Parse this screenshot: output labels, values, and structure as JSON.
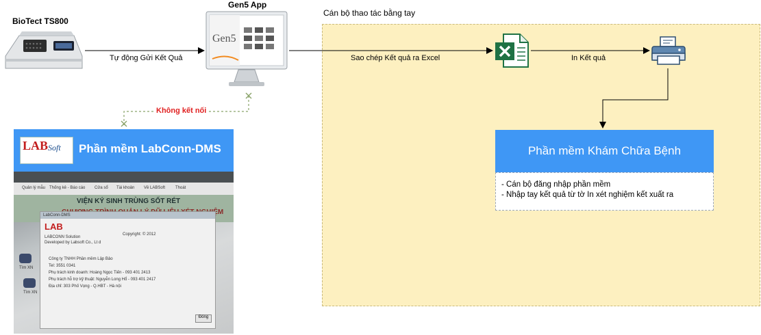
{
  "devices": {
    "biotek_label": "BioTect TS800",
    "gen5_label": "Gen5 App",
    "gen5_screen_text": "Gen5"
  },
  "edges": {
    "auto_send": "Tự động Gửi Kết Quả",
    "copy_excel": "Sao chép Kết quả ra Excel",
    "print_result": "In Kết quả",
    "no_connection": "Không kết nối"
  },
  "manual_area": {
    "title": "Cán bộ thao tác bằng tay",
    "fill_color": "#fdf0c0"
  },
  "exam_software": {
    "title": "Phần mềm Khám Chữa Bệnh",
    "lines": [
      "- Cán bộ đăng nhập phần mềm",
      "- Nhập tay kết quả từ tờ In xét nghiệm kết xuất ra"
    ],
    "header_color": "#3f97f5"
  },
  "labconn": {
    "title": "Phần mềm LabConn-DMS",
    "logo_text": "LAB",
    "logo_soft": "Soft",
    "photo": {
      "banner_line1": "VIỆN KÝ SINH TRÙNG SỐT RÉT",
      "banner_line2": "CHƯƠNG TRÌNH QUẢN LÝ DỮ LIỆU XÉT NGHIỆM",
      "menu_items": [
        "Quản lý mẫu",
        "Thống kê - Báo cáo",
        "Cửa sổ",
        "Tài khoản",
        "Về LABSoft",
        "Thoát"
      ],
      "dialog_title": "LabConn-DMS",
      "dialog_logo": "LAB",
      "dialog_lines": [
        "LABCONN Solution",
        "Developed by Labsoft Co., Lt d",
        "Copyright: © 2012",
        "Công ty TNHH Phần mềm Lập Bảo",
        "Tel: 3551 0341",
        "Phụ trách kinh doanh: Hoàng Ngọc Tiến - 093 401 2413",
        "Phụ trách hỗ trợ kỹ thuật: Nguyễn Long Hổ - 093 401 2417",
        "Địa chỉ: 303 Phố Vọng - Q.HBT - Hà nội"
      ],
      "desktop_icons": [
        "Tìm XN",
        "Tìm XN"
      ],
      "ok_button": "Đóng"
    }
  },
  "colors": {
    "accent_blue": "#3f97f5",
    "excel_green": "#1f7244",
    "warning_red": "#e02020",
    "dashed_green": "#8aa36a"
  }
}
